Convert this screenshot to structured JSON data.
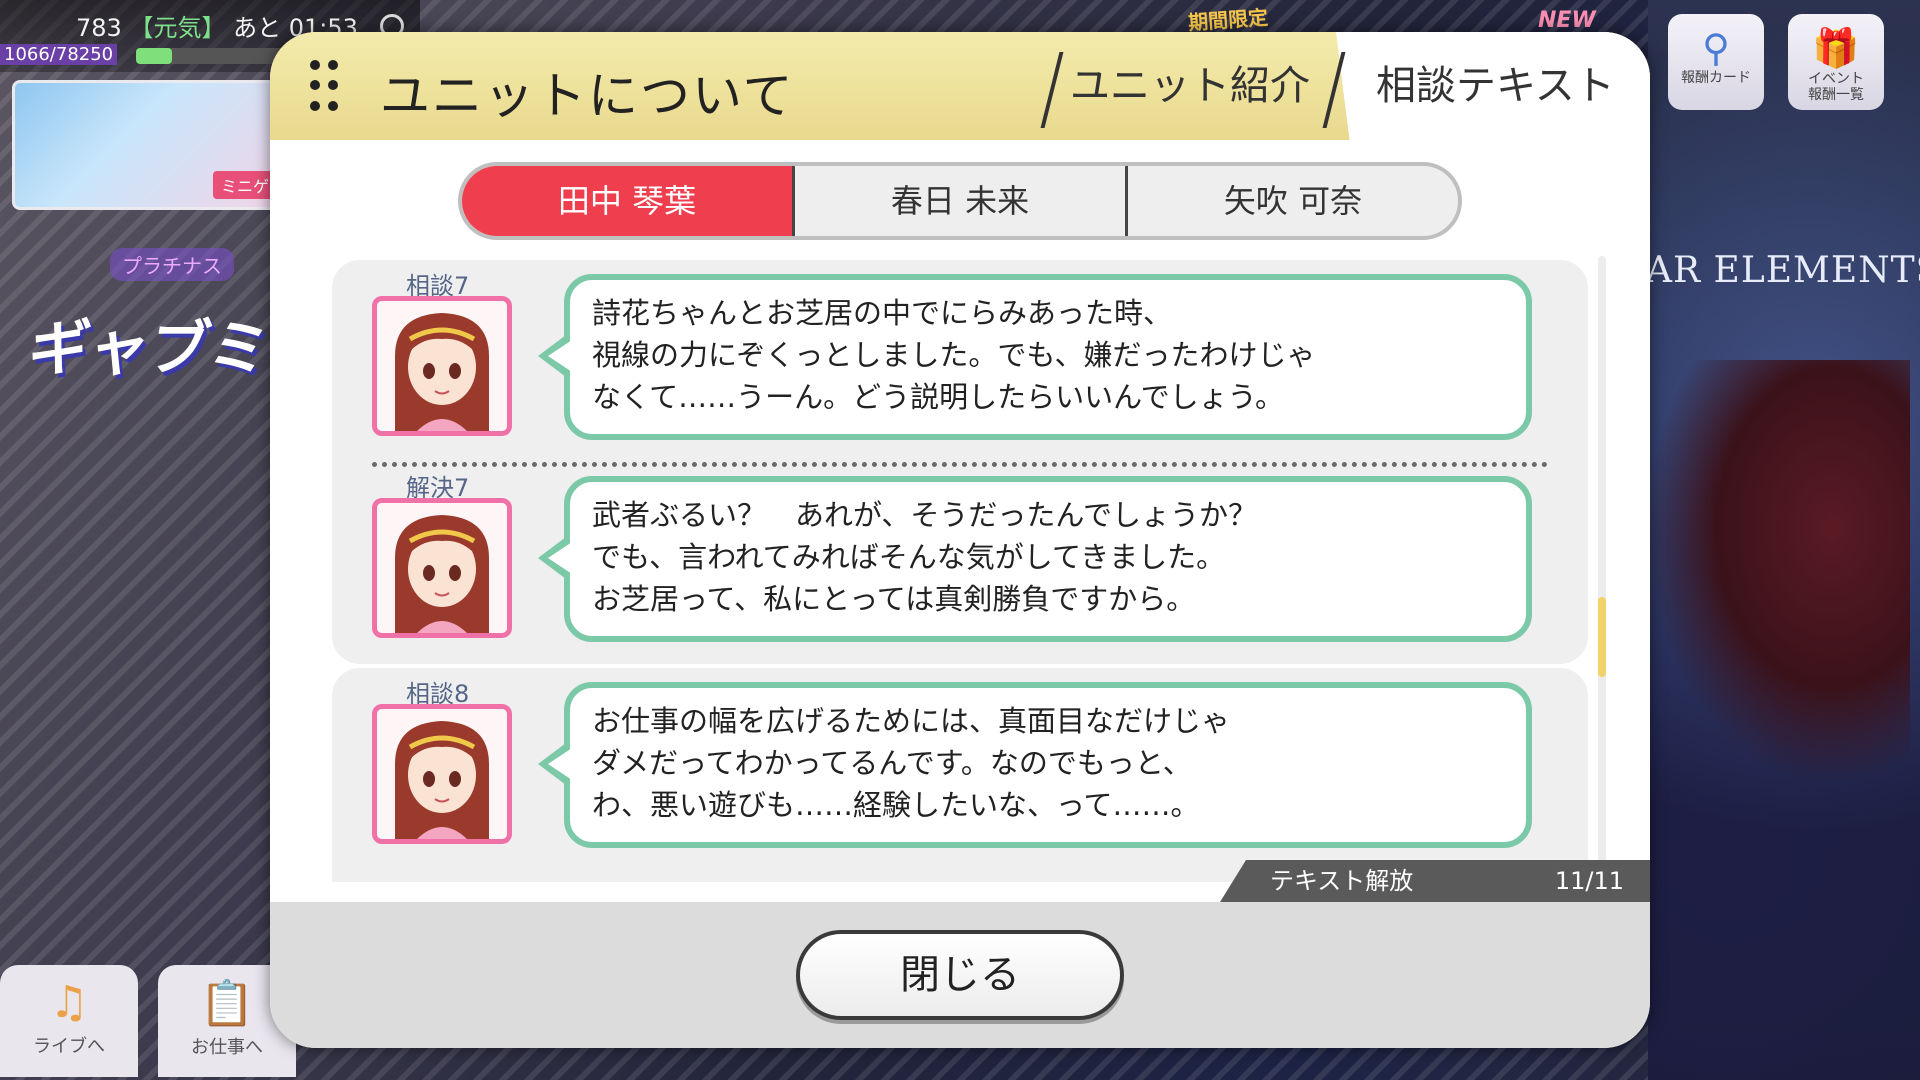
{
  "status": {
    "points": "783",
    "mood_tag": "【元気】",
    "remaining_label": "あと 01:53",
    "stamina_text": "1066/78250",
    "stamina_fraction": 0.125
  },
  "background": {
    "platinum_label": "プラチナス",
    "right_title": "AR ELEMENTS",
    "limited_tag": "期間限定",
    "new_tag": "NEW",
    "banner_badge": "ミニゲー"
  },
  "top_icons": [
    {
      "label_line1": "報酬カード",
      "label_line2": ""
    },
    {
      "label_line1": "イベント",
      "label_line2": "報酬一覧"
    }
  ],
  "bottom_nav": [
    {
      "label": "ライブへ"
    },
    {
      "label": "お仕事へ"
    }
  ],
  "dialog": {
    "title": "ユニットについて",
    "tabs": [
      {
        "label": "ユニット紹介",
        "active": false
      },
      {
        "label": "相談テキスト",
        "active": true
      }
    ],
    "characters": [
      {
        "name": "田中 琴葉",
        "active": true
      },
      {
        "name": "春日 未来",
        "active": false
      },
      {
        "name": "矢吹 可奈",
        "active": false
      }
    ],
    "entries": [
      {
        "label": "相談7",
        "lines": [
          "詩花ちゃんとお芝居の中でにらみあった時、",
          "視線の力にぞくっとしました。でも、嫌だったわけじゃ",
          "なくて……うーん。どう説明したらいいんでしょう。"
        ]
      },
      {
        "label": "解決7",
        "lines": [
          "武者ぶるい？　あれが、そうだったんでしょうか？",
          "でも、言われてみればそんな気がしてきました。",
          "お芝居って、私にとっては真剣勝負ですから。"
        ]
      },
      {
        "label": "相談8",
        "lines": [
          "お仕事の幅を広げるためには、真面目なだけじゃ",
          "ダメだってわかってるんです。なのでもっと、",
          "わ、悪い遊びも……経験したいな、って……。"
        ]
      }
    ],
    "release": {
      "label": "テキスト解放",
      "count": "11/11"
    },
    "close_label": "閉じる",
    "colors": {
      "accent_active": "#ef3e4d",
      "bubble_border": "#7cc9a8",
      "portrait_border": "#f070a8",
      "header_bg": "#eedf98"
    }
  }
}
